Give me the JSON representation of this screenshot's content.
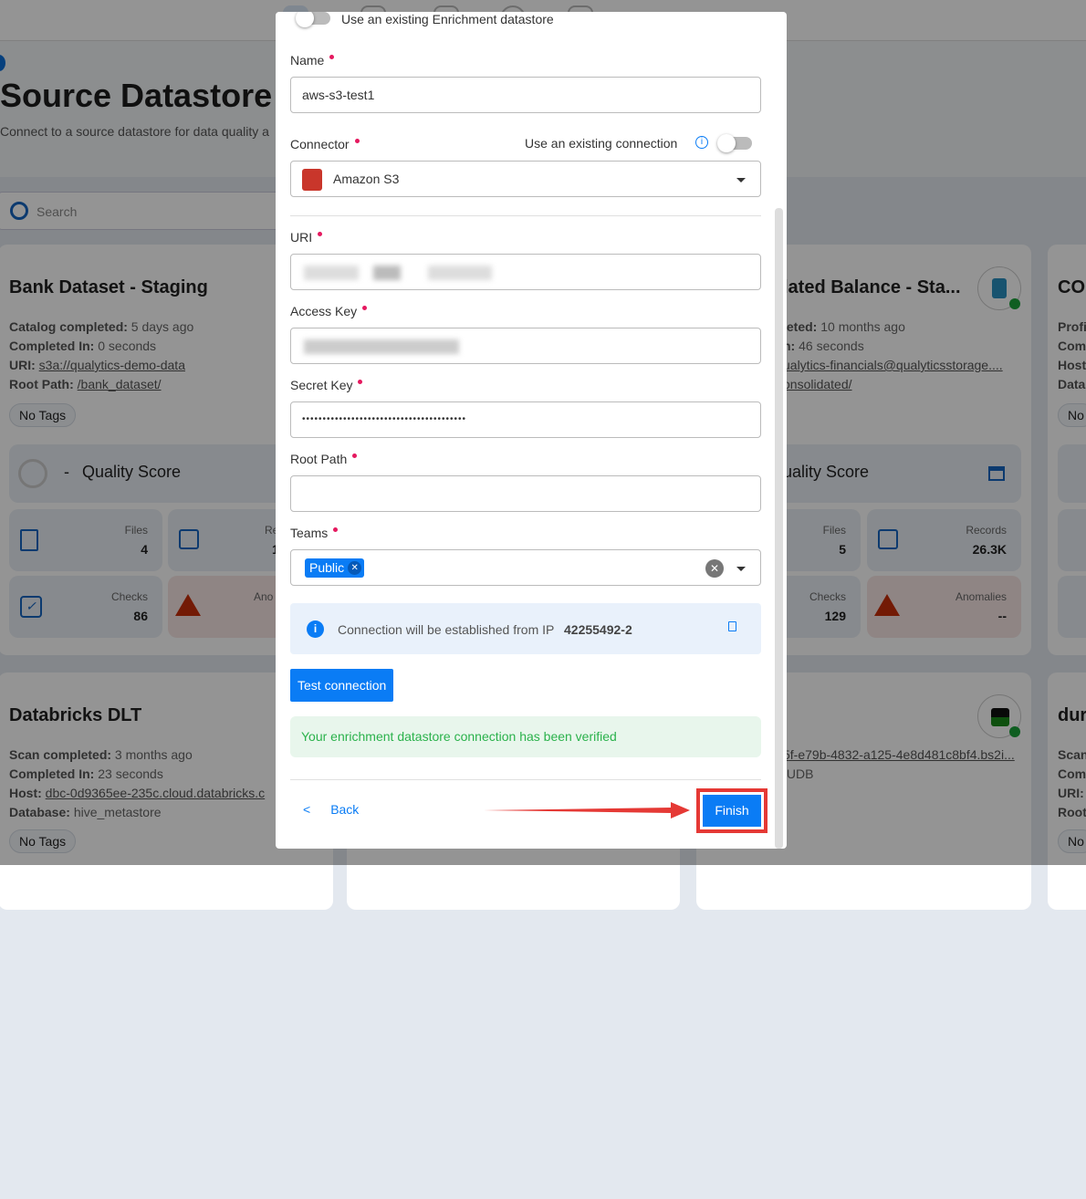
{
  "page": {
    "title": "Source Datastore",
    "subtitle": "Connect to a source datastore for data quality a",
    "search_placeholder": "Search"
  },
  "cards": [
    {
      "title": "Bank Dataset - Staging",
      "meta": [
        {
          "k": "Catalog completed:",
          "v": "5 days ago"
        },
        {
          "k": "Completed In:",
          "v": "0 seconds"
        },
        {
          "k": "URI:",
          "v": "s3a://qualytics-demo-data",
          "link": true
        },
        {
          "k": "Root Path:",
          "v": "/bank_dataset/",
          "link": true
        }
      ],
      "tag": "No Tags",
      "quality_score": "-",
      "quality_label": "Quality Score",
      "files_label": "Files",
      "files": "4",
      "records_label": "Re",
      "records": "1",
      "checks_label": "Checks",
      "checks": "86",
      "anomalies_label": "Ano"
    },
    {
      "title": "lated Balance - Sta...",
      "meta": [
        {
          "k": "leted:",
          "v": "10 months ago"
        },
        {
          "k": "n:",
          "v": "46 seconds"
        },
        {
          "k": "",
          "v": "ualytics-financials@qualyticsstorage....",
          "link": true
        },
        {
          "k": "",
          "v": "onsolidated/",
          "link": true
        }
      ],
      "quality_label": "uality Score",
      "files_label": "Files",
      "files": "5",
      "records_label": "Records",
      "records": "26.3K",
      "checks_label": "Checks",
      "checks": "129",
      "anomalies_label": "Anomalies",
      "anomalies": "--"
    },
    {
      "title": "CO",
      "meta": [
        "Profi",
        "Com",
        "Host",
        "Data"
      ],
      "tag": "No"
    },
    {
      "title": "Databricks DLT",
      "meta": [
        {
          "k": "Scan completed:",
          "v": "3 months ago"
        },
        {
          "k": "Completed In:",
          "v": "23 seconds"
        },
        {
          "k": "Host:",
          "v": "dbc-0d9365ee-235c.cloud.databricks.c",
          "link": true
        },
        {
          "k": "Database:",
          "v": "hive_metastore"
        }
      ],
      "tag": "No Tags"
    },
    {
      "meta": [
        "5f-e79b-4832-a125-4e8d481c8bf4.bs2i...",
        ".UDB"
      ],
      "logo": "IBM DB2"
    },
    {
      "title": "dur",
      "meta": [
        "Scan",
        "Com",
        "URI:",
        "Root"
      ],
      "tag": "No"
    }
  ],
  "modal": {
    "enrichment_toggle_label": "Use an existing Enrichment datastore",
    "name_label": "Name",
    "name_value": "aws-s3-test1",
    "connector_label": "Connector",
    "existing_connection_label": "Use an existing connection",
    "connector_value": "Amazon S3",
    "uri_label": "URI",
    "access_key_label": "Access Key",
    "secret_key_label": "Secret Key",
    "secret_key_value": "••••••••••••••••••••••••••••••••••••••••",
    "root_path_label": "Root Path",
    "root_path_value": "",
    "teams_label": "Teams",
    "team_chip": "Public",
    "ip_info_text": "Connection will be established from IP",
    "ip_value": "42255492-2",
    "test_button": "Test connection",
    "success_message": "Your enrichment datastore connection has been verified",
    "back_button": "Back",
    "finish_button": "Finish"
  },
  "colors": {
    "primary": "#0a7cf5",
    "required": "#e5195f",
    "success_bg": "#e8f6ec",
    "success_text": "#2bb24c",
    "highlight": "#e53935"
  }
}
